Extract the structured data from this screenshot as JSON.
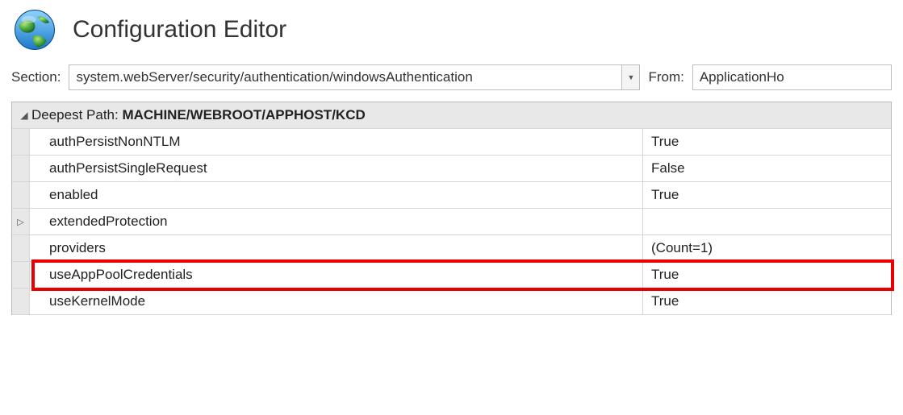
{
  "header": {
    "title": "Configuration Editor"
  },
  "toolbar": {
    "section_label": "Section:",
    "section_value": "system.webServer/security/authentication/windowsAuthentication",
    "from_label": "From:",
    "from_value": "ApplicationHo"
  },
  "grid": {
    "path_label": "Deepest Path: ",
    "path_value": "MACHINE/WEBROOT/APPHOST/KCD",
    "rows": [
      {
        "name": "authPersistNonNTLM",
        "value": "True",
        "expandable": false
      },
      {
        "name": "authPersistSingleRequest",
        "value": "False",
        "expandable": false
      },
      {
        "name": "enabled",
        "value": "True",
        "expandable": false
      },
      {
        "name": "extendedProtection",
        "value": "",
        "expandable": true
      },
      {
        "name": "providers",
        "value": "(Count=1)",
        "expandable": false
      },
      {
        "name": "useAppPoolCredentials",
        "value": "True",
        "expandable": false,
        "highlighted": true
      },
      {
        "name": "useKernelMode",
        "value": "True",
        "expandable": false
      }
    ]
  }
}
